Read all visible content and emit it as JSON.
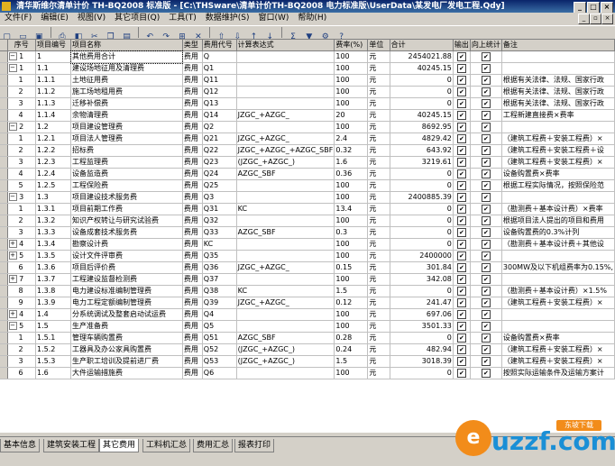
{
  "window": {
    "title": "清华斯维尔清单计价 TH-BQ2008 标准版 - [C:\\THSware\\清单计价TH-BQ2008 电力标准版\\UserData\\某发电厂发电工程.Qdy]"
  },
  "menu": [
    "文件(F)",
    "编辑(E)",
    "视图(V)",
    "其它项目(Q)",
    "工具(T)",
    "数据维护(S)",
    "窗口(W)",
    "帮助(H)"
  ],
  "columns": [
    "序号",
    "项目编号",
    "项目名称",
    "类型",
    "费用代号",
    "计算表达式",
    "费率(%)",
    "单位",
    "合计",
    "输出",
    "向上统计",
    "备注"
  ],
  "rows": [
    {
      "seq": "1",
      "code": "1",
      "name": "其他费用合计",
      "type": "费用",
      "fcode": "Q",
      "expr": "",
      "rate": "100",
      "unit": "元",
      "total": "2454021.88",
      "out": true,
      "up": true,
      "note": "",
      "exp": "minus",
      "sel": true
    },
    {
      "seq": "1",
      "code": "1.1",
      "name": "建设场地征用及清理费",
      "type": "费用",
      "fcode": "Q1",
      "expr": "",
      "rate": "100",
      "unit": "元",
      "total": "40245.15",
      "out": true,
      "up": true,
      "note": "",
      "exp": "minus"
    },
    {
      "seq": "1",
      "code": "1.1.1",
      "name": "土地征用费",
      "type": "费用",
      "fcode": "Q11",
      "expr": "",
      "rate": "100",
      "unit": "元",
      "total": "0",
      "out": true,
      "up": true,
      "note": "根据有关法律、法规、国家行政",
      "exp": ""
    },
    {
      "seq": "2",
      "code": "1.1.2",
      "name": "施工场地租用费",
      "type": "费用",
      "fcode": "Q12",
      "expr": "",
      "rate": "100",
      "unit": "元",
      "total": "0",
      "out": true,
      "up": true,
      "note": "根据有关法律、法规、国家行政",
      "exp": ""
    },
    {
      "seq": "3",
      "code": "1.1.3",
      "name": "迁移补偿费",
      "type": "费用",
      "fcode": "Q13",
      "expr": "",
      "rate": "100",
      "unit": "元",
      "total": "0",
      "out": true,
      "up": true,
      "note": "根据有关法律、法规、国家行政",
      "exp": ""
    },
    {
      "seq": "4",
      "code": "1.1.4",
      "name": "余物清理费",
      "type": "费用",
      "fcode": "Q14",
      "expr": "JZGC_+AZGC_",
      "rate": "20",
      "unit": "元",
      "total": "40245.15",
      "out": true,
      "up": true,
      "note": "工程新建直接费×费率",
      "exp": ""
    },
    {
      "seq": "2",
      "code": "1.2",
      "name": "项目建设管理费",
      "type": "费用",
      "fcode": "Q2",
      "expr": "",
      "rate": "100",
      "unit": "元",
      "total": "8692.95",
      "out": true,
      "up": true,
      "note": "",
      "exp": "minus"
    },
    {
      "seq": "1",
      "code": "1.2.1",
      "name": "项目法人管理费",
      "type": "费用",
      "fcode": "Q21",
      "expr": "JZGC_+AZGC_",
      "rate": "2.4",
      "unit": "元",
      "total": "4829.42",
      "out": true,
      "up": true,
      "note": "（建筑工程费＋安装工程费）×",
      "exp": ""
    },
    {
      "seq": "2",
      "code": "1.2.2",
      "name": "招标费",
      "type": "费用",
      "fcode": "Q22",
      "expr": "JZGC_+AZGC_+AZGC_SBF",
      "rate": "0.32",
      "unit": "元",
      "total": "643.92",
      "out": true,
      "up": true,
      "note": "（建筑工程费＋安装工程费＋设",
      "exp": ""
    },
    {
      "seq": "3",
      "code": "1.2.3",
      "name": "工程监理费",
      "type": "费用",
      "fcode": "Q23",
      "expr": "(JZGC_+AZGC_)",
      "rate": "1.6",
      "unit": "元",
      "total": "3219.61",
      "out": true,
      "up": true,
      "note": "（建筑工程费＋安装工程费）×",
      "exp": ""
    },
    {
      "seq": "4",
      "code": "1.2.4",
      "name": "设备监造费",
      "type": "费用",
      "fcode": "Q24",
      "expr": "AZGC_SBF",
      "rate": "0.36",
      "unit": "元",
      "total": "0",
      "out": true,
      "up": true,
      "note": "设备购置费×费率",
      "exp": ""
    },
    {
      "seq": "5",
      "code": "1.2.5",
      "name": "工程保险费",
      "type": "费用",
      "fcode": "Q25",
      "expr": "",
      "rate": "100",
      "unit": "元",
      "total": "0",
      "out": true,
      "up": true,
      "note": "根据工程实际情况，按照保险范",
      "exp": ""
    },
    {
      "seq": "3",
      "code": "1.3",
      "name": "项目建设技术服务费",
      "type": "费用",
      "fcode": "Q3",
      "expr": "",
      "rate": "100",
      "unit": "元",
      "total": "2400885.39",
      "out": true,
      "up": true,
      "note": "",
      "exp": "minus"
    },
    {
      "seq": "1",
      "code": "1.3.1",
      "name": "项目前期工作费",
      "type": "费用",
      "fcode": "Q31",
      "expr": "KC",
      "rate": "13.4",
      "unit": "元",
      "total": "0",
      "out": true,
      "up": true,
      "note": "（勘测费＋基本设计费）×费率",
      "exp": ""
    },
    {
      "seq": "2",
      "code": "1.3.2",
      "name": "知识产权转让与研究试验费",
      "type": "费用",
      "fcode": "Q32",
      "expr": "",
      "rate": "100",
      "unit": "元",
      "total": "0",
      "out": true,
      "up": true,
      "note": "根据项目法人提出的项目和费用",
      "exp": ""
    },
    {
      "seq": "3",
      "code": "1.3.3",
      "name": "设备成套技术服务费",
      "type": "费用",
      "fcode": "Q33",
      "expr": "AZGC_SBF",
      "rate": "0.3",
      "unit": "元",
      "total": "0",
      "out": true,
      "up": true,
      "note": "设备购置费的0.3%计列",
      "exp": ""
    },
    {
      "seq": "4",
      "code": "1.3.4",
      "name": "勘察设计费",
      "type": "费用",
      "fcode": "KC",
      "expr": "",
      "rate": "100",
      "unit": "元",
      "total": "0",
      "out": true,
      "up": true,
      "note": "（勘测费＋基本设计费＋其他设",
      "exp": "plus"
    },
    {
      "seq": "5",
      "code": "1.3.5",
      "name": "设计文件评审费",
      "type": "费用",
      "fcode": "Q35",
      "expr": "",
      "rate": "100",
      "unit": "元",
      "total": "2400000",
      "out": true,
      "up": true,
      "note": "",
      "exp": "plus"
    },
    {
      "seq": "6",
      "code": "1.3.6",
      "name": "项目后评价费",
      "type": "费用",
      "fcode": "Q36",
      "expr": "JZGC_+AZGC_",
      "rate": "0.15",
      "unit": "元",
      "total": "301.84",
      "out": true,
      "up": true,
      "note": "300MW及以下机组费率为0.15%,",
      "exp": ""
    },
    {
      "seq": "7",
      "code": "1.3.7",
      "name": "工程建设监督检测费",
      "type": "费用",
      "fcode": "Q37",
      "expr": "",
      "rate": "100",
      "unit": "元",
      "total": "342.08",
      "out": true,
      "up": true,
      "note": "",
      "exp": "plus"
    },
    {
      "seq": "8",
      "code": "1.3.8",
      "name": "电力建设标准编制管理费",
      "type": "费用",
      "fcode": "Q38",
      "expr": "KC",
      "rate": "1.5",
      "unit": "元",
      "total": "0",
      "out": true,
      "up": true,
      "note": "（勘测费＋基本设计费）×1.5%",
      "exp": ""
    },
    {
      "seq": "9",
      "code": "1.3.9",
      "name": "电力工程定额编制管理费",
      "type": "费用",
      "fcode": "Q39",
      "expr": "JZGC_+AZGC_",
      "rate": "0.12",
      "unit": "元",
      "total": "241.47",
      "out": true,
      "up": true,
      "note": "（建筑工程费＋安装工程费）×",
      "exp": ""
    },
    {
      "seq": "4",
      "code": "1.4",
      "name": "分系统调试及整套启动试运费",
      "type": "费用",
      "fcode": "Q4",
      "expr": "",
      "rate": "100",
      "unit": "元",
      "total": "697.06",
      "out": true,
      "up": true,
      "note": "",
      "exp": "plus"
    },
    {
      "seq": "5",
      "code": "1.5",
      "name": "生产准备费",
      "type": "费用",
      "fcode": "Q5",
      "expr": "",
      "rate": "100",
      "unit": "元",
      "total": "3501.33",
      "out": true,
      "up": true,
      "note": "",
      "exp": "minus"
    },
    {
      "seq": "1",
      "code": "1.5.1",
      "name": "管理车辆购置费",
      "type": "费用",
      "fcode": "Q51",
      "expr": "AZGC_SBF",
      "rate": "0.28",
      "unit": "元",
      "total": "0",
      "out": true,
      "up": true,
      "note": "设备购置费×费率",
      "exp": ""
    },
    {
      "seq": "2",
      "code": "1.5.2",
      "name": "工器具及办公家具购置费",
      "type": "费用",
      "fcode": "Q52",
      "expr": "(JZGC_+AZGC_)",
      "rate": "0.24",
      "unit": "元",
      "total": "482.94",
      "out": true,
      "up": true,
      "note": "（建筑工程费＋安装工程费）×",
      "exp": ""
    },
    {
      "seq": "3",
      "code": "1.5.3",
      "name": "生产职工培训及提前进厂费",
      "type": "费用",
      "fcode": "Q53",
      "expr": "(JZGC_+AZGC_)",
      "rate": "1.5",
      "unit": "元",
      "total": "3018.39",
      "out": true,
      "up": true,
      "note": "（建筑工程费＋安装工程费）×",
      "exp": ""
    },
    {
      "seq": "6",
      "code": "1.6",
      "name": "大件运输措施费",
      "type": "费用",
      "fcode": "Q6",
      "expr": "",
      "rate": "100",
      "unit": "元",
      "total": "0",
      "out": true,
      "up": true,
      "note": "按照实际运输条件及运输方案计",
      "exp": ""
    }
  ],
  "tabs": [
    "基本信息",
    "建筑安装工程",
    "其它费用",
    "工料机汇总",
    "费用汇总",
    "报表打印"
  ],
  "active_tab": 2,
  "watermark": {
    "brand": "uzzf",
    "domain": ".com",
    "badge": "东坡下载",
    "symbol": "e"
  }
}
